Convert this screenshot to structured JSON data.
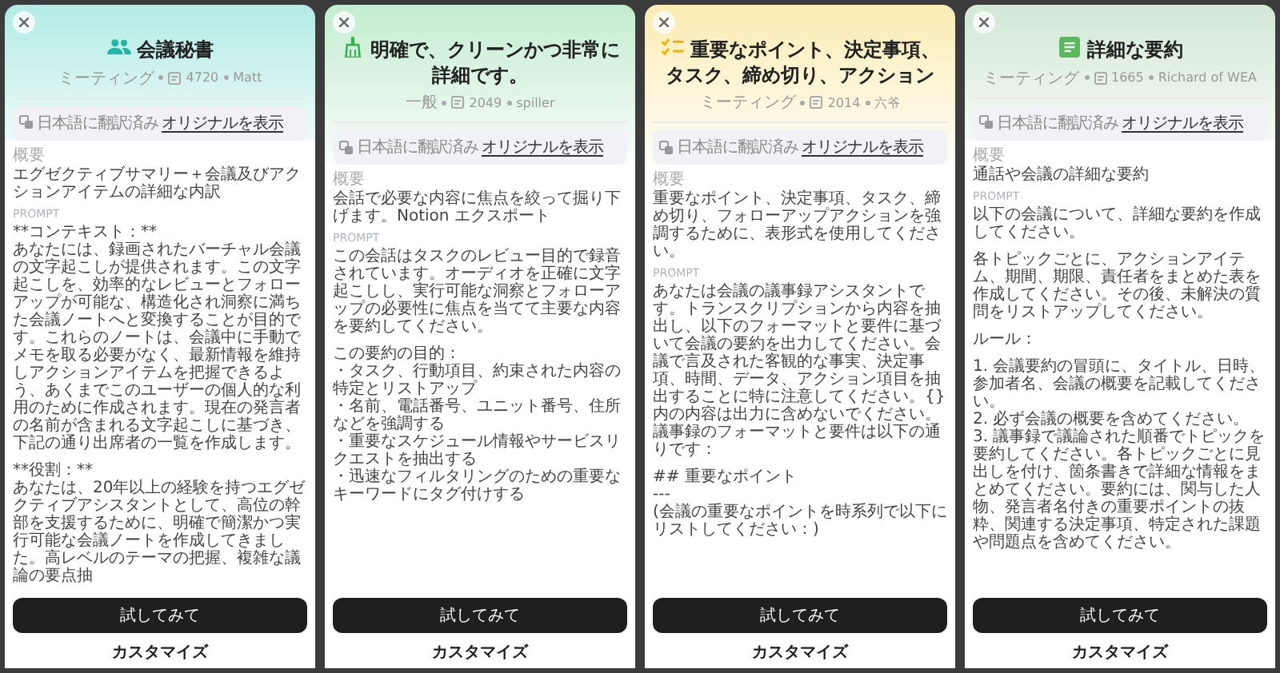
{
  "cards": [
    {
      "kind": "people",
      "color": "#b2ebe5",
      "title": "会議秘書",
      "meta": {
        "category": "ミーティング",
        "count": "4720",
        "author": "Matt"
      },
      "translation": {
        "note": "日本語に翻訳済み",
        "link": "オリジナルを表示"
      },
      "summary_label": "概要",
      "summary": "エグゼクティブサマリー＋会議及びアクションアイテムの詳細な内訳",
      "prompt_label": "PROMPT",
      "prompt": [
        [
          "**コンテキスト：**",
          "あなたには、録画されたバーチャル会議の文字起こしが提供されます。この文字起こしを、効率的なレビューとフォローアップが可能な、構造化され洞察に満ちた会議ノートへと変換することが目的です。これらのノートは、会議中に手動でメモを取る必要がなく、最新情報を維持しアクションアイテムを把握できるよう、あくまでこのユーザーの個人的な利用のために作成されます。現在の発言者の名前が含まれる文字起こしに基づき、下記の通り出席者の一覧を作成します。"
        ],
        [
          "**役割：**",
          "あなたは、20年以上の経験を持つエグゼクティブアシスタントとして、高位の幹部を支援するために、明確で簡潔かつ実行可能な会議ノートを作成してきました。高レベルのテーマの把握、複雑な議論の要点抽"
        ]
      ],
      "try_button": "試してみて",
      "customize": "カスタマイズ"
    },
    {
      "kind": "broom",
      "color": "#c3ecd0",
      "title": "明確で、クリーンかつ非常に詳細です。",
      "meta": {
        "category": "一般",
        "count": "2049",
        "author": "spiller"
      },
      "translation": {
        "note": "日本語に翻訳済み",
        "link": "オリジナルを表示"
      },
      "summary_label": "概要",
      "summary": "会話で必要な内容に焦点を絞って掘り下げます。Notion エクスポート",
      "prompt_label": "PROMPT",
      "prompt": [
        [
          "この会話はタスクのレビュー目的で録音されています。オーディオを正確に文字起こしし、実行可能な洞察とフォローアップの必要性に焦点を当てて主要な内容を要約してください。"
        ],
        [
          "この要約の目的：",
          "・タスク、行動項目、約束された内容の特定とリストアップ",
          "・名前、電話番号、ユニット番号、住所などを強調する",
          "・重要なスケジュール情報やサービスリクエストを抽出する",
          "・迅速なフィルタリングのための重要なキーワードにタグ付けする"
        ]
      ],
      "try_button": "試してみて",
      "customize": "カスタマイズ"
    },
    {
      "kind": "checklist",
      "color": "#fbecb3",
      "title": "重要なポイント、決定事項、タスク、締め切り、アクション",
      "meta": {
        "category": "ミーティング",
        "count": "2014",
        "author": "六爷"
      },
      "translation": {
        "note": "日本語に翻訳済み",
        "link": "オリジナルを表示"
      },
      "summary_label": "概要",
      "summary": "重要なポイント、決定事項、タスク、締め切り、フォローアップアクションを強調するために、表形式を使用してください。",
      "prompt_label": "PROMPT",
      "prompt": [
        [
          "あなたは会議の議事録アシスタントです。トランスクリプションから内容を抽出し、以下のフォーマットと要件に基づいて会議の要約を出力してください。会議で言及された客観的な事実、決定事項、時間、データ、アクション項目を抽出することに特に注意してください。{}内の内容は出力に含めないでください。議事録のフォーマットと要件は以下の通りです："
        ],
        [
          "## 重要なポイント",
          "---",
          "(会議の重要なポイントを時系列で以下にリストしてください：)"
        ]
      ],
      "try_button": "試してみて",
      "customize": "カスタマイズ"
    },
    {
      "kind": "document",
      "color": "#d3e8d6",
      "title": "詳細な要約",
      "meta": {
        "category": "ミーティング",
        "count": "1665",
        "author": "Richard of WEA"
      },
      "translation": {
        "note": "日本語に翻訳済み",
        "link": "オリジナルを表示"
      },
      "summary_label": "概要",
      "summary": "通話や会議の詳細な要約",
      "prompt_label": "PROMPT",
      "prompt": [
        [
          "以下の会議について、詳細な要約を作成してください。"
        ],
        [
          "各トピックごとに、アクションアイテム、期間、期限、責任者をまとめた表を作成してください。その後、未解決の質問をリストアップしてください。"
        ],
        [
          "ルール："
        ],
        [
          "1. 会議要約の冒頭に、タイトル、日時、参加者名、会議の概要を記載してください。",
          "2. 必ず会議の概要を含めてください。",
          "3. 議事録で議論された順番でトピックを要約してください。各トピックごとに見出しを付け、箇条書きで詳細な情報をまとめてください。要約には、関与した人物、発言者名付きの重要ポイントの抜粋、関連する決定事項、特定された課題や問題点を含めてください。"
        ]
      ],
      "try_button": "試してみて",
      "customize": "カスタマイズ"
    }
  ]
}
